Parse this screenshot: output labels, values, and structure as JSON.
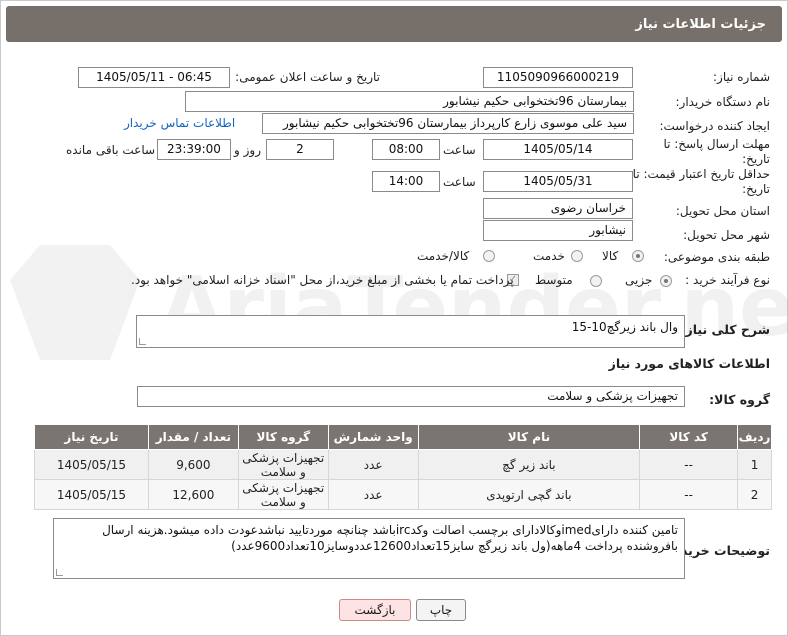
{
  "header": {
    "title": "جزئیات اطلاعات نیاز"
  },
  "watermark": {
    "text": "AriaTender.net"
  },
  "fields": {
    "need_number": {
      "label": "شماره نیاز:",
      "value": "1105090966000219"
    },
    "announce_datetime": {
      "label": "تاریخ و ساعت اعلان عمومی:",
      "value": "1405/05/11 - 06:45"
    },
    "buyer_org": {
      "label": "نام دستگاه خریدار:",
      "value": "بیمارستان 96تختخوابی حکیم نیشابور"
    },
    "requester": {
      "label": "ایجاد کننده درخواست:",
      "value": "سید علی  موسوی زارع کارپرداز بیمارستان 96تختخوابی حکیم نیشابور",
      "contact_link": "اطلاعات تماس خریدار"
    },
    "reply_deadline": {
      "label": "مهلت ارسال پاسخ: تا تاریخ:",
      "date": "1405/05/14",
      "time_label": "ساعت",
      "time": "08:00",
      "days": "2",
      "days_label": "روز و",
      "remaining": "23:39:00",
      "remaining_label": "ساعت باقی مانده"
    },
    "price_validity": {
      "label": "حداقل تاریخ اعتبار قیمت: تا تاریخ:",
      "date": "1405/05/31",
      "time_label": "ساعت",
      "time": "14:00"
    },
    "delivery_province": {
      "label": "استان محل تحویل:",
      "value": "خراسان رضوی"
    },
    "delivery_city": {
      "label": "شهر محل تحویل:",
      "value": "نیشابور"
    },
    "category": {
      "label": "طبقه بندی موضوعی:",
      "options": [
        "کالا",
        "خدمت",
        "کالا/خدمت"
      ],
      "selected": "کالا"
    },
    "process_type": {
      "label": "نوع فرآیند خرید :",
      "options": [
        "جزیی",
        "متوسط"
      ],
      "selected": "جزیی",
      "payment_note": "پرداخت تمام یا بخشی از مبلغ خرید،از محل \"اسناد خزانه اسلامی\" خواهد بود."
    }
  },
  "description": {
    "label": "شرح کلی نیاز:",
    "value": "وال باند زیرگچ10-15"
  },
  "goods_info": {
    "title": "اطلاعات کالاهای مورد نیاز"
  },
  "goods_group": {
    "label": "گروه کالا:",
    "value": "تجهیزات پزشکی و سلامت"
  },
  "table": {
    "headers": [
      "ردیف",
      "کد کالا",
      "نام کالا",
      "واحد شمارش",
      "گروه کالا",
      "تعداد / مقدار",
      "تاریخ نیاز"
    ],
    "rows": [
      [
        "1",
        "--",
        "باند زیر گچ",
        "عدد",
        "تجهیزات پزشکی و سلامت",
        "9,600",
        "1405/05/15"
      ],
      [
        "2",
        "--",
        "باند گچی ارتوپدی",
        "عدد",
        "تجهیزات پزشکی و سلامت",
        "12,600",
        "1405/05/15"
      ]
    ]
  },
  "buyer_notes": {
    "label": "توضیحات خریدار:",
    "value": "تامین کننده دارایimedوکالادارای برچسب اصالت وکدircباشد چنانچه موردتایید نباشدعودت داده میشود.هزینه ارسال بافروشنده پرداخت 4ماهه(ول باند زیرگچ سایز15تعداد12600عددوسایز10تعداد9600عدد)"
  },
  "buttons": {
    "print": "چاپ",
    "back": "بازگشت"
  }
}
